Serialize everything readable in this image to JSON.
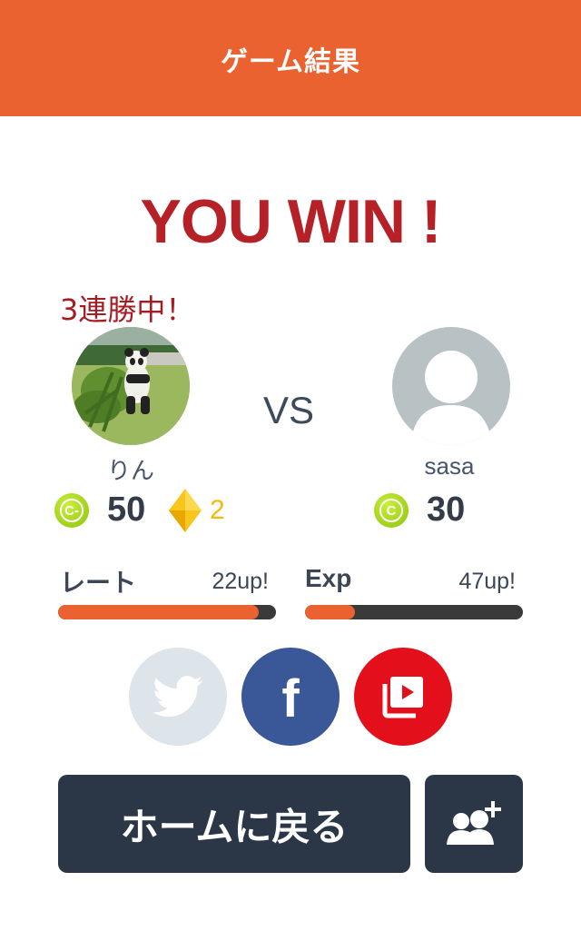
{
  "header": {
    "title": "ゲーム結果"
  },
  "result": {
    "title": "YOU WIN !",
    "streak": "3連勝中！"
  },
  "player": {
    "name": "りん",
    "coin_label": "C-",
    "coins": "50",
    "gems": "2"
  },
  "versus": {
    "label": "VS"
  },
  "opponent": {
    "name": "sasa",
    "coin_label": "C",
    "coins": "30"
  },
  "rate": {
    "label": "レート",
    "up_text": "22up!",
    "fill_fraction": 0.92
  },
  "exp": {
    "label": "Exp",
    "up_text": "47up!",
    "fill_fraction": 0.23
  },
  "share": {
    "icons": [
      "twitter-icon",
      "facebook-icon",
      "video-icon"
    ],
    "facebook_glyph": "f"
  },
  "actions": {
    "home_label": "ホームに戻る",
    "add_friend_icon": "add-friend-icon"
  },
  "colors": {
    "header": "#e9622f",
    "win": "#b52126",
    "progress": "#e9622f",
    "facebook": "#3a5897",
    "video": "#e3101b",
    "twitter_disabled": "#dde4ea",
    "button": "#2b3646",
    "gem": "#f2b80b",
    "coin": "#8cc20c"
  }
}
